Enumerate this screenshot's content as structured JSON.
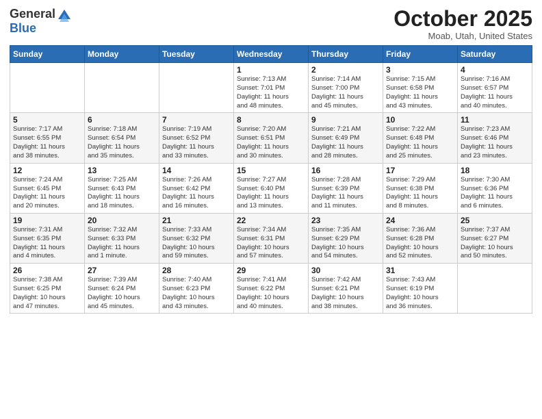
{
  "header": {
    "logo_general": "General",
    "logo_blue": "Blue",
    "month_title": "October 2025",
    "location": "Moab, Utah, United States"
  },
  "days_of_week": [
    "Sunday",
    "Monday",
    "Tuesday",
    "Wednesday",
    "Thursday",
    "Friday",
    "Saturday"
  ],
  "weeks": [
    [
      {
        "day": "",
        "info": ""
      },
      {
        "day": "",
        "info": ""
      },
      {
        "day": "",
        "info": ""
      },
      {
        "day": "1",
        "info": "Sunrise: 7:13 AM\nSunset: 7:01 PM\nDaylight: 11 hours\nand 48 minutes."
      },
      {
        "day": "2",
        "info": "Sunrise: 7:14 AM\nSunset: 7:00 PM\nDaylight: 11 hours\nand 45 minutes."
      },
      {
        "day": "3",
        "info": "Sunrise: 7:15 AM\nSunset: 6:58 PM\nDaylight: 11 hours\nand 43 minutes."
      },
      {
        "day": "4",
        "info": "Sunrise: 7:16 AM\nSunset: 6:57 PM\nDaylight: 11 hours\nand 40 minutes."
      }
    ],
    [
      {
        "day": "5",
        "info": "Sunrise: 7:17 AM\nSunset: 6:55 PM\nDaylight: 11 hours\nand 38 minutes."
      },
      {
        "day": "6",
        "info": "Sunrise: 7:18 AM\nSunset: 6:54 PM\nDaylight: 11 hours\nand 35 minutes."
      },
      {
        "day": "7",
        "info": "Sunrise: 7:19 AM\nSunset: 6:52 PM\nDaylight: 11 hours\nand 33 minutes."
      },
      {
        "day": "8",
        "info": "Sunrise: 7:20 AM\nSunset: 6:51 PM\nDaylight: 11 hours\nand 30 minutes."
      },
      {
        "day": "9",
        "info": "Sunrise: 7:21 AM\nSunset: 6:49 PM\nDaylight: 11 hours\nand 28 minutes."
      },
      {
        "day": "10",
        "info": "Sunrise: 7:22 AM\nSunset: 6:48 PM\nDaylight: 11 hours\nand 25 minutes."
      },
      {
        "day": "11",
        "info": "Sunrise: 7:23 AM\nSunset: 6:46 PM\nDaylight: 11 hours\nand 23 minutes."
      }
    ],
    [
      {
        "day": "12",
        "info": "Sunrise: 7:24 AM\nSunset: 6:45 PM\nDaylight: 11 hours\nand 20 minutes."
      },
      {
        "day": "13",
        "info": "Sunrise: 7:25 AM\nSunset: 6:43 PM\nDaylight: 11 hours\nand 18 minutes."
      },
      {
        "day": "14",
        "info": "Sunrise: 7:26 AM\nSunset: 6:42 PM\nDaylight: 11 hours\nand 16 minutes."
      },
      {
        "day": "15",
        "info": "Sunrise: 7:27 AM\nSunset: 6:40 PM\nDaylight: 11 hours\nand 13 minutes."
      },
      {
        "day": "16",
        "info": "Sunrise: 7:28 AM\nSunset: 6:39 PM\nDaylight: 11 hours\nand 11 minutes."
      },
      {
        "day": "17",
        "info": "Sunrise: 7:29 AM\nSunset: 6:38 PM\nDaylight: 11 hours\nand 8 minutes."
      },
      {
        "day": "18",
        "info": "Sunrise: 7:30 AM\nSunset: 6:36 PM\nDaylight: 11 hours\nand 6 minutes."
      }
    ],
    [
      {
        "day": "19",
        "info": "Sunrise: 7:31 AM\nSunset: 6:35 PM\nDaylight: 11 hours\nand 4 minutes."
      },
      {
        "day": "20",
        "info": "Sunrise: 7:32 AM\nSunset: 6:33 PM\nDaylight: 11 hours\nand 1 minute."
      },
      {
        "day": "21",
        "info": "Sunrise: 7:33 AM\nSunset: 6:32 PM\nDaylight: 10 hours\nand 59 minutes."
      },
      {
        "day": "22",
        "info": "Sunrise: 7:34 AM\nSunset: 6:31 PM\nDaylight: 10 hours\nand 57 minutes."
      },
      {
        "day": "23",
        "info": "Sunrise: 7:35 AM\nSunset: 6:29 PM\nDaylight: 10 hours\nand 54 minutes."
      },
      {
        "day": "24",
        "info": "Sunrise: 7:36 AM\nSunset: 6:28 PM\nDaylight: 10 hours\nand 52 minutes."
      },
      {
        "day": "25",
        "info": "Sunrise: 7:37 AM\nSunset: 6:27 PM\nDaylight: 10 hours\nand 50 minutes."
      }
    ],
    [
      {
        "day": "26",
        "info": "Sunrise: 7:38 AM\nSunset: 6:25 PM\nDaylight: 10 hours\nand 47 minutes."
      },
      {
        "day": "27",
        "info": "Sunrise: 7:39 AM\nSunset: 6:24 PM\nDaylight: 10 hours\nand 45 minutes."
      },
      {
        "day": "28",
        "info": "Sunrise: 7:40 AM\nSunset: 6:23 PM\nDaylight: 10 hours\nand 43 minutes."
      },
      {
        "day": "29",
        "info": "Sunrise: 7:41 AM\nSunset: 6:22 PM\nDaylight: 10 hours\nand 40 minutes."
      },
      {
        "day": "30",
        "info": "Sunrise: 7:42 AM\nSunset: 6:21 PM\nDaylight: 10 hours\nand 38 minutes."
      },
      {
        "day": "31",
        "info": "Sunrise: 7:43 AM\nSunset: 6:19 PM\nDaylight: 10 hours\nand 36 minutes."
      },
      {
        "day": "",
        "info": ""
      }
    ]
  ]
}
